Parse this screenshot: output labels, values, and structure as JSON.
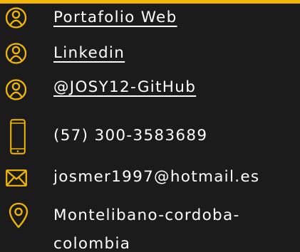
{
  "accent_color": "#f2b705",
  "background_color": "#1b1b1b",
  "text_color": "#ffffff",
  "contacts": [
    {
      "icon": "person-icon",
      "text": "Portafolio Web",
      "link": true
    },
    {
      "icon": "person-icon",
      "text": "Linkedin",
      "link": true
    },
    {
      "icon": "person-icon",
      "text": "@JOSY12-GitHub",
      "link": true
    },
    {
      "icon": "mobile-phone-icon",
      "text": "(57) 300-3583689",
      "link": false
    },
    {
      "icon": "envelope-icon",
      "text": "josmer1997@hotmail.es",
      "link": false
    },
    {
      "icon": "location-pin-icon",
      "text": "Montelibano-cordoba-colombia",
      "link": false
    }
  ]
}
